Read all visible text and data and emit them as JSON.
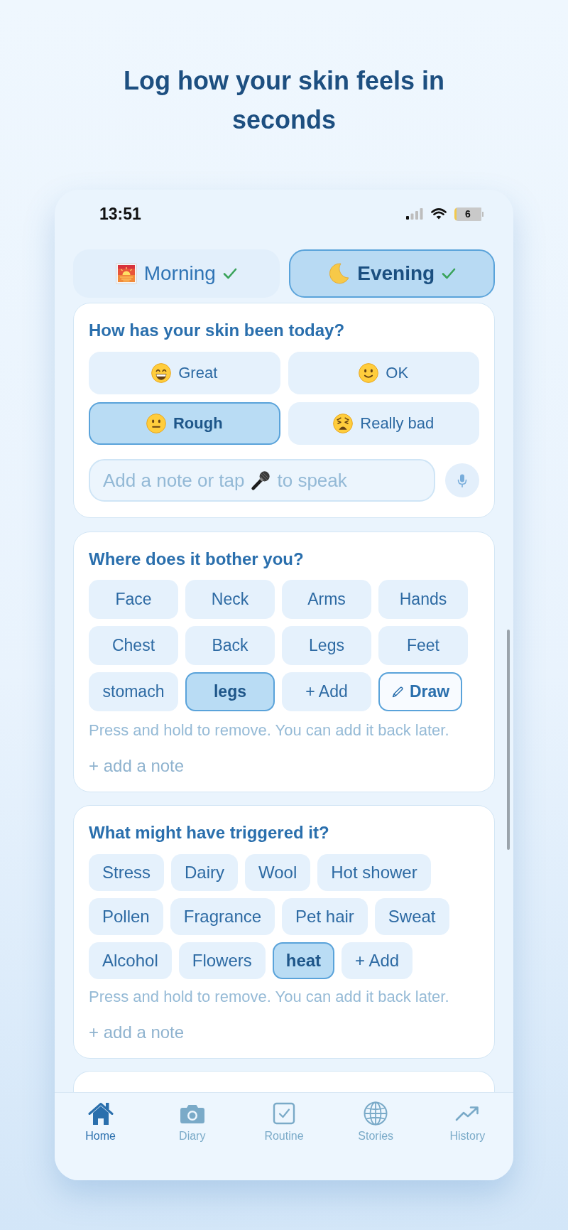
{
  "headline": "Log how your skin feels in seconds",
  "status_bar": {
    "time": "13:51",
    "battery": "6"
  },
  "session_tabs": [
    {
      "label": "Morning",
      "selected": false,
      "done": true
    },
    {
      "label": "Evening",
      "selected": true,
      "done": true
    }
  ],
  "skin_card": {
    "title": "How has your skin been today?",
    "options": [
      {
        "label": "Great",
        "selected": false
      },
      {
        "label": "OK",
        "selected": false
      },
      {
        "label": "Rough",
        "selected": true
      },
      {
        "label": "Really bad",
        "selected": false
      }
    ],
    "note_field": {
      "placeholder_start": "Add a note or tap",
      "placeholder_end": "to speak"
    }
  },
  "areas_card": {
    "title": "Where does it bother you?",
    "chips": [
      {
        "label": "Face",
        "kind": "chip",
        "selected": false
      },
      {
        "label": "Neck",
        "kind": "chip",
        "selected": false
      },
      {
        "label": "Arms",
        "kind": "chip",
        "selected": false
      },
      {
        "label": "Hands",
        "kind": "chip",
        "selected": false
      },
      {
        "label": "Chest",
        "kind": "chip",
        "selected": false
      },
      {
        "label": "Back",
        "kind": "chip",
        "selected": false
      },
      {
        "label": "Legs",
        "kind": "chip",
        "selected": false
      },
      {
        "label": "Feet",
        "kind": "chip",
        "selected": false
      },
      {
        "label": "stomach",
        "kind": "chip",
        "selected": false
      },
      {
        "label": "legs",
        "kind": "chip",
        "selected": true
      },
      {
        "label": "+ Add",
        "kind": "chip",
        "selected": false
      },
      {
        "label": "Draw",
        "kind": "draw",
        "selected": false
      }
    ],
    "hint": "Press and hold to remove. You can add it back later.",
    "add_note": "+ add a note"
  },
  "triggers_card": {
    "title": "What might have triggered it?",
    "chips": [
      {
        "label": "Stress",
        "selected": false
      },
      {
        "label": "Dairy",
        "selected": false
      },
      {
        "label": "Wool",
        "selected": false
      },
      {
        "label": "Hot shower",
        "selected": false
      },
      {
        "label": "Pollen",
        "selected": false
      },
      {
        "label": "Fragrance",
        "selected": false
      },
      {
        "label": "Pet hair",
        "selected": false
      },
      {
        "label": "Sweat",
        "selected": false
      },
      {
        "label": "Alcohol",
        "selected": false
      },
      {
        "label": "Flowers",
        "selected": false
      },
      {
        "label": "heat",
        "selected": true
      },
      {
        "label": "+ Add",
        "selected": false
      }
    ],
    "hint": "Press and hold to remove. You can add it back later.",
    "add_note": "+ add a note"
  },
  "nav_tabs": [
    {
      "label": "Home",
      "selected": true
    },
    {
      "label": "Diary",
      "selected": false
    },
    {
      "label": "Routine",
      "selected": false
    },
    {
      "label": "Stories",
      "selected": false
    },
    {
      "label": "History",
      "selected": false
    }
  ]
}
